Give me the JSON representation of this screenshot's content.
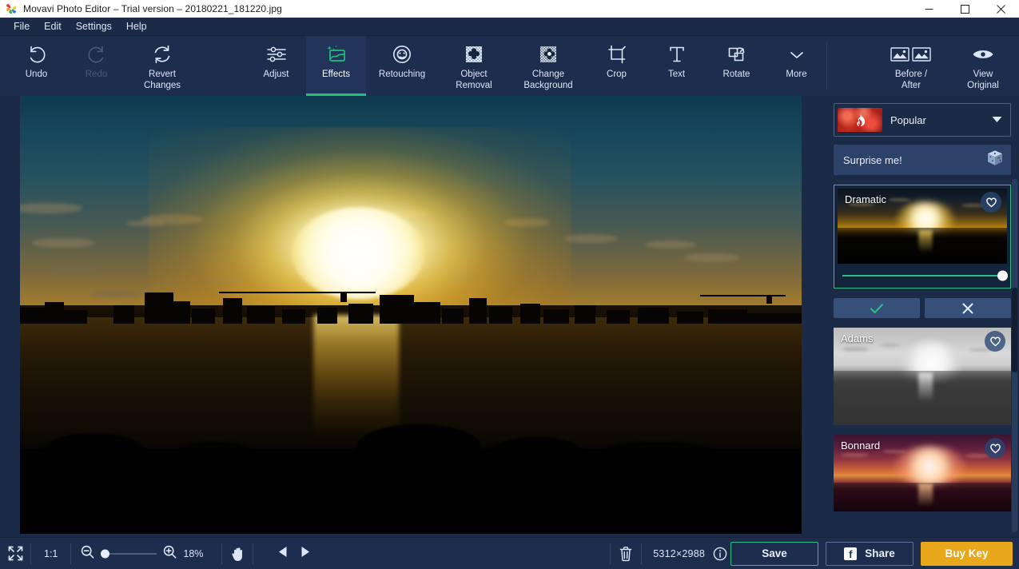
{
  "window": {
    "title": "Movavi Photo Editor – Trial version – 20180221_181220.jpg",
    "logo_icon": "movavi-pinwheel-logo",
    "minimize_icon": "minimize-icon",
    "maximize_icon": "maximize-icon",
    "close_icon": "close-icon"
  },
  "menubar": {
    "items": [
      {
        "label": "File"
      },
      {
        "label": "Edit"
      },
      {
        "label": "Settings"
      },
      {
        "label": "Help"
      }
    ]
  },
  "toolbar": {
    "left_group": [
      {
        "label": "Undo",
        "icon": "undo-arrow-icon",
        "enabled": true
      },
      {
        "label": "Redo",
        "icon": "redo-arrow-icon",
        "enabled": false
      },
      {
        "label": "Revert\nChanges",
        "icon": "revert-refresh-icon",
        "enabled": true
      }
    ],
    "center_group": [
      {
        "label": "Adjust",
        "icon": "sliders-icon",
        "active": false
      },
      {
        "label": "Effects",
        "icon": "effects-sparkle-icon",
        "active": true
      },
      {
        "label": "Retouching",
        "icon": "face-retouch-icon",
        "active": false
      },
      {
        "label": "Object\nRemoval",
        "icon": "object-removal-icon",
        "active": false
      },
      {
        "label": "Change\nBackground",
        "icon": "change-background-icon",
        "active": false
      },
      {
        "label": "Crop",
        "icon": "crop-icon",
        "active": false
      },
      {
        "label": "Text",
        "icon": "text-t-icon",
        "active": false
      },
      {
        "label": "Rotate",
        "icon": "rotate-icon",
        "active": false
      },
      {
        "label": "More",
        "icon": "chevron-down-icon",
        "active": false
      }
    ],
    "right_group": [
      {
        "label": "Before /\nAfter",
        "icon": "before-after-icon"
      },
      {
        "label": "View\nOriginal",
        "icon": "eye-icon"
      }
    ],
    "active_accent": "#22c07e"
  },
  "sidebar": {
    "category": {
      "label": "Popular",
      "thumb_icon": "flame-icon",
      "caret_icon": "chevron-down-icon"
    },
    "surprise": {
      "label": "Surprise me!",
      "icon": "dice-icon"
    },
    "effects": [
      {
        "name": "Dramatic",
        "selected": true,
        "favorite_icon": "heart-icon",
        "slider_value": 100
      },
      {
        "name": "Adams",
        "selected": false,
        "favorite_icon": "heart-icon"
      },
      {
        "name": "Bonnard",
        "selected": false,
        "favorite_icon": "heart-icon"
      }
    ],
    "card_actions": {
      "apply_icon": "check-icon",
      "cancel_icon": "close-x-icon"
    }
  },
  "bottombar": {
    "fullscreen_icon": "fullscreen-expand-icon",
    "ratio_label": "1:1",
    "zoom_out_icon": "zoom-out-icon",
    "zoom_in_icon": "zoom-in-icon",
    "zoom_percent": "18%",
    "zoom_slider_value": 18,
    "hand_icon": "hand-pan-icon",
    "prev_icon": "previous-triangle-icon",
    "next_icon": "next-triangle-icon",
    "delete_icon": "trash-icon",
    "dimensions": "5312×2988",
    "info_icon": "info-circle-icon",
    "save_label": "Save",
    "share_label": "Share",
    "share_icon": "facebook-icon",
    "buy_label": "Buy Key",
    "buy_color": "#e9a81b",
    "save_border_color": "#2fbf86"
  }
}
